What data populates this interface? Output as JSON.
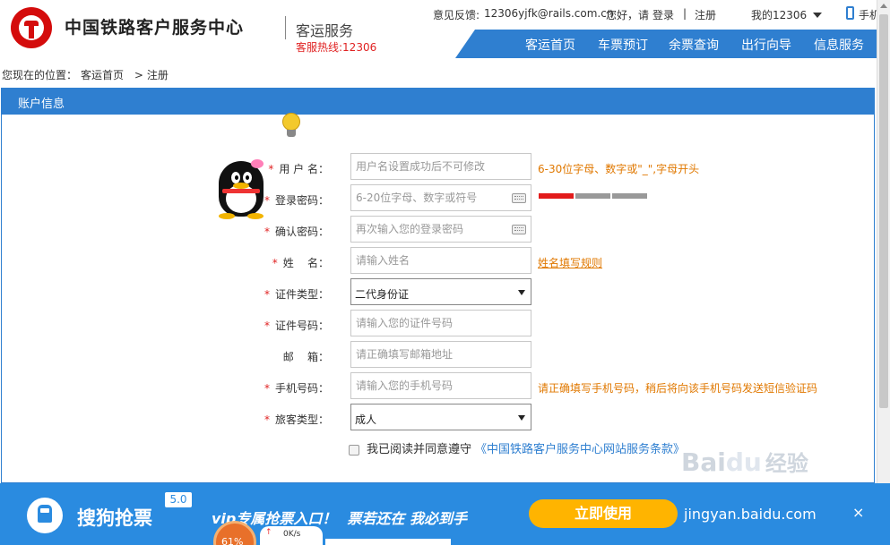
{
  "header": {
    "brand": "中国铁路客户服务中心",
    "sub": "客运服务",
    "hotline": "客服热线:12306",
    "feedback_label": "意见反馈:",
    "feedback_email": "12306yjfk@rails.com.cn",
    "greeting": "您好，请",
    "login": "登录",
    "divider": "|",
    "register": "注册",
    "my12306": "我的12306",
    "mobile": "手机",
    "nav": [
      "客运首页",
      "车票预订",
      "余票查询",
      "出行向导",
      "信息服务"
    ]
  },
  "breadcrumb": {
    "prefix": "您现在的位置：",
    "home": "客运首页",
    "sep": ">",
    "current": "注册"
  },
  "panel": {
    "title": "账户信息"
  },
  "form": {
    "username": {
      "label": "用 户 名：",
      "placeholder": "用户名设置成功后不可修改",
      "hint": "6-30位字母、数字或\"_\",字母开头"
    },
    "password": {
      "label": "登录密码：",
      "placeholder": "6-20位字母、数字或符号",
      "strength": 0.33
    },
    "confirm": {
      "label": "确认密码：",
      "placeholder": "再次输入您的登录密码"
    },
    "name": {
      "label": "姓    名：",
      "placeholder": "请输入姓名",
      "hint": "姓名填写规则"
    },
    "id_type": {
      "label": "证件类型：",
      "value": "二代身份证"
    },
    "id_number": {
      "label": "证件号码：",
      "placeholder": "请输入您的证件号码"
    },
    "email": {
      "label": "邮    箱：",
      "placeholder": "请正确填写邮箱地址"
    },
    "phone": {
      "label": "手机号码：",
      "placeholder": "请输入您的手机号码",
      "hint": "请正确填写手机号码，稍后将向该手机号码发送短信验证码"
    },
    "passenger_type": {
      "label": "旅客类型：",
      "value": "成人"
    },
    "agree_text": "我已阅读并同意遵守",
    "terms": "《中国铁路客户服务中心网站服务条款》"
  },
  "banner": {
    "title": "搜狗抢票",
    "version": "5.0",
    "slogan1": "vip专属抢票入口！",
    "slogan2": "票若还在 我必到手",
    "button": "立即使用",
    "url": "jingyan.baidu.com",
    "close": "×",
    "gauge": "61%",
    "speed": "0K/s",
    "speed_arrow": "↑"
  },
  "watermark": {
    "text_a": "Bai",
    "text_b": "du",
    "text_c": "经验"
  },
  "colors": {
    "primary": "#2f7fd0",
    "required": "#e02222",
    "hint": "#e07800",
    "banner": "#2a8be0",
    "button": "#ffb400"
  }
}
